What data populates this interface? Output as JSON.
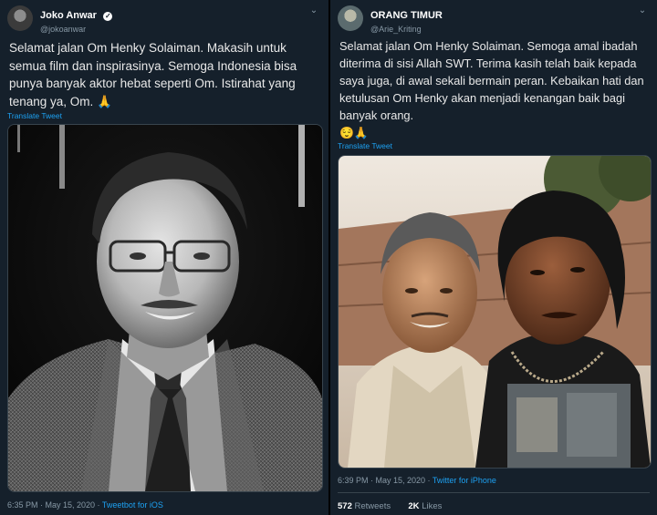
{
  "left_tweet": {
    "name": "Joko Anwar",
    "handle": "@jokoanwar",
    "text": "Selamat jalan Om Henky Solaiman. Makasih untuk semua film dan inspirasinya. Semoga Indonesia bisa punya banyak aktor hebat seperti Om. Istirahat yang tenang ya, Om. 🙏",
    "translate": "Translate Tweet",
    "time": "6:35 PM · May 15, 2020 · ",
    "source": "Tweetbot for iOS",
    "icon": "verified-badge",
    "image_alt": "black and white portrait photo"
  },
  "right_tweet": {
    "name": "ORANG TIMUR",
    "handle": "@Arie_Kriting",
    "text": "Selamat jalan Om Henky Solaiman. Semoga amal ibadah diterima di sisi Allah SWT. Terima kasih telah baik kepada saya juga, di awal sekali bermain peran. Kebaikan hati dan ketulusan Om Henky akan menjadi kenangan baik bagi banyak orang.",
    "emoji": "😌🙏",
    "translate": "Translate Tweet",
    "time": "6:39 PM · May 15, 2020 · ",
    "source": "Twitter for iPhone",
    "retweets": "572",
    "retweets_label": "Retweets",
    "likes": "2K",
    "likes_label": "Likes",
    "image_alt": "selfie photo of two men"
  },
  "colors": {
    "background": "#15202b",
    "link": "#1da1f2",
    "muted": "#8899a6"
  }
}
